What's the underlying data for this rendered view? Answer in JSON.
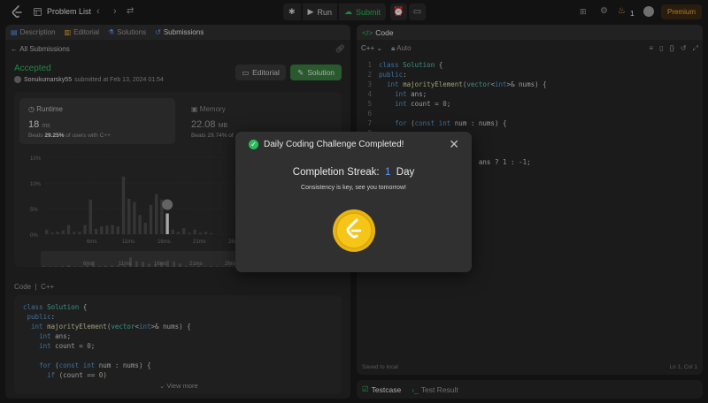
{
  "topbar": {
    "title": "Problem List",
    "run_label": "Run",
    "submit_label": "Submit",
    "streak_count": "1",
    "premium_label": "Premium"
  },
  "left_panel": {
    "tabs": [
      {
        "label": "Description"
      },
      {
        "label": "Editorial"
      },
      {
        "label": "Solutions"
      },
      {
        "label": "Submissions"
      }
    ],
    "back_label": "All Submissions",
    "status": "Accepted",
    "author": "Sonukumarsky55",
    "submitted_text": "submitted at Feb 13, 2024 01:54",
    "editorial_btn": "Editorial",
    "solution_btn": "Solution",
    "runtime": {
      "label": "Runtime",
      "value": "18",
      "unit": "ms",
      "beats_prefix": "Beats",
      "beats_pct": "29.25%",
      "beats_suffix": "of users with C++"
    },
    "memory": {
      "label": "Memory",
      "value": "22.08",
      "unit": "MB",
      "beats_text": "Beats 29.74% of"
    },
    "code_label": "Code",
    "code_lang": "C++",
    "view_more": "View more",
    "code_lines": [
      "class Solution {",
      "public:",
      "  int majorityElement(vector<int>& nums) {",
      "    int ans;",
      "    int count = 0;",
      "",
      "    for (const int num : nums) {",
      "      if (count == 0)"
    ]
  },
  "chart_data": {
    "type": "bar",
    "y_ticks": [
      "10%",
      "10%",
      "5%",
      "0%"
    ],
    "x_ticks": [
      "6ms",
      "11ms",
      "16ms",
      "21ms",
      "26ms"
    ],
    "mini_x_ticks": [
      "6ms",
      "11ms",
      "16ms",
      "21ms",
      "26ms"
    ],
    "values": [
      0.6,
      0.2,
      0.3,
      0.5,
      1.2,
      0.3,
      0.3,
      1.2,
      4.5,
      0.7,
      1.0,
      1.1,
      1.2,
      1.0,
      7.5,
      4.6,
      4.2,
      2.5,
      1.5,
      3.8,
      5.2,
      4.5,
      2.7,
      0.6,
      0.3,
      0.8,
      0.2,
      0.6,
      0.2,
      0.3,
      0.1
    ],
    "highlight_index": 22
  },
  "right_panel": {
    "header": "Code",
    "language": "C++",
    "autosave": "Auto",
    "lines": [
      "class Solution {",
      "public:",
      "  int majorityElement(vector<int>& nums) {",
      "    int ans;",
      "    int count = 0;",
      "",
      "    for (const int num : nums) {",
      "",
      "",
      "",
      "                     ans ? 1 : -1;"
    ],
    "saved_text": "Saved to local",
    "cursor_text": "Ln 1, Col 1",
    "testcase_label": "Testcase",
    "test_result_label": "Test Result"
  },
  "modal": {
    "title": "Daily Coding Challenge Completed!",
    "streak_label": "Completion Streak:",
    "streak_value": "1",
    "streak_unit": "Day",
    "message": "Consistency is key, see you tomorrow!"
  },
  "colors": {
    "accent_green": "#2cbb5d",
    "accent_blue": "#5b9cff",
    "premium": "#f2a93b",
    "coin": "#f5c518"
  }
}
